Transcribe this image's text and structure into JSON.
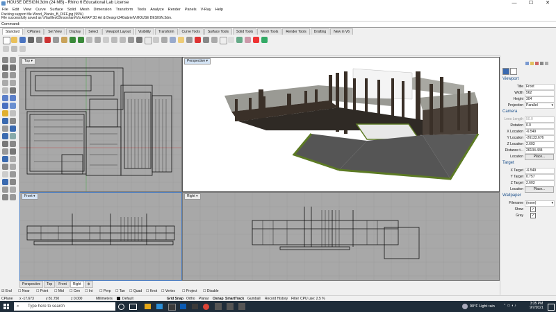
{
  "window": {
    "title": "HOUSE DESIGN.3dm (24 MB) - Rhino 6 Educational Lab License",
    "controls": {
      "minimize": "—",
      "maximize": "☐",
      "close": "✕"
    }
  },
  "menu": [
    "File",
    "Edit",
    "View",
    "Curve",
    "Surface",
    "Solid",
    "Mesh",
    "Dimension",
    "Transform",
    "Tools",
    "Analyze",
    "Render",
    "Panels",
    "V-Ray",
    "Help"
  ],
  "command_history": [
    "Packing support file Wood_Planks_B_DIFF.jpg (99%)",
    "File successfully saved as \\Vlasfiles03\\nsoshani\\Vis Art\\AP 3D Art & Design\\24GabrielV\\HOUSE DESIGN.3dm."
  ],
  "command_prompt": "Command:",
  "toolbar_tabs": [
    "Standard",
    "CPlanes",
    "Set View",
    "Display",
    "Select",
    "Viewport Layout",
    "Visibility",
    "Transform",
    "Curve Tools",
    "Surface Tools",
    "Solid Tools",
    "Mesh Tools",
    "Render Tools",
    "Drafting",
    "New in V6"
  ],
  "viewports": {
    "top": "Top",
    "perspective": "Perspective",
    "front": "Front",
    "right": "Right"
  },
  "viewport_tabs": [
    "Perspective",
    "Top",
    "Front",
    "Right",
    "⊕"
  ],
  "panel": {
    "section_viewport": "Viewport",
    "title_label": "Title",
    "title_value": "Front",
    "width_label": "Width",
    "width_value": "562",
    "height_label": "Height",
    "height_value": "304",
    "projection_label": "Projection",
    "projection_value": "Parallel",
    "section_camera": "Camera",
    "lens_label": "Lens Length",
    "lens_value": "50.0",
    "rotation_label": "Rotation",
    "rotation_value": "0.0",
    "xloc_label": "X Location",
    "xloc_value": "-6.549",
    "yloc_label": "Y Location",
    "yloc_value": "-26133.676",
    "zloc_label": "Z Location",
    "zloc_value": "2.603",
    "dist_label": "Distance t...",
    "dist_value": "26134.434",
    "loc_label": "Location",
    "place": "Place...",
    "section_target": "Target",
    "xt_label": "X Target",
    "xt_value": "-6.549",
    "yt_label": "Y Target",
    "yt_value": "0.757",
    "zt_label": "Z Target",
    "zt_value": "2.603",
    "section_wallpaper": "Wallpaper",
    "file_label": "Filename",
    "file_value": "(none)",
    "show_label": "Show",
    "gray_label": "Gray",
    "check": "✓"
  },
  "osnaps": [
    "End",
    "Near",
    "Point",
    "Mid",
    "Cen",
    "Int",
    "Perp",
    "Tan",
    "Quad",
    "Knot",
    "Vertex",
    "Project",
    "Disable"
  ],
  "status": {
    "cplane": "CPlane",
    "x": "x -17.673",
    "y": "y 81.750",
    "z": "z 0.000",
    "units": "Millimeters",
    "layer": "Default",
    "grid_snap": "Grid Snap",
    "ortho": "Ortho",
    "planar": "Planar",
    "osnap": "Osnap",
    "smarttrack": "SmartTrack",
    "gumball": "Gumball",
    "record_history": "Record History",
    "filter": "Filter",
    "cpu": "CPU use: 2.5 %"
  },
  "taskbar": {
    "search_placeholder": "Type here to search",
    "weather": "90°F  Light rain",
    "time": "3:35 PM",
    "date": "9/7/2021"
  },
  "colors": {
    "viewport_bg": "#a8a8a8",
    "grass": "#5c7a24",
    "concrete": "#9a9a94",
    "dark_wood": "#3a3028",
    "asphalt": "#555555",
    "taskbar": "#1f2d3a"
  }
}
